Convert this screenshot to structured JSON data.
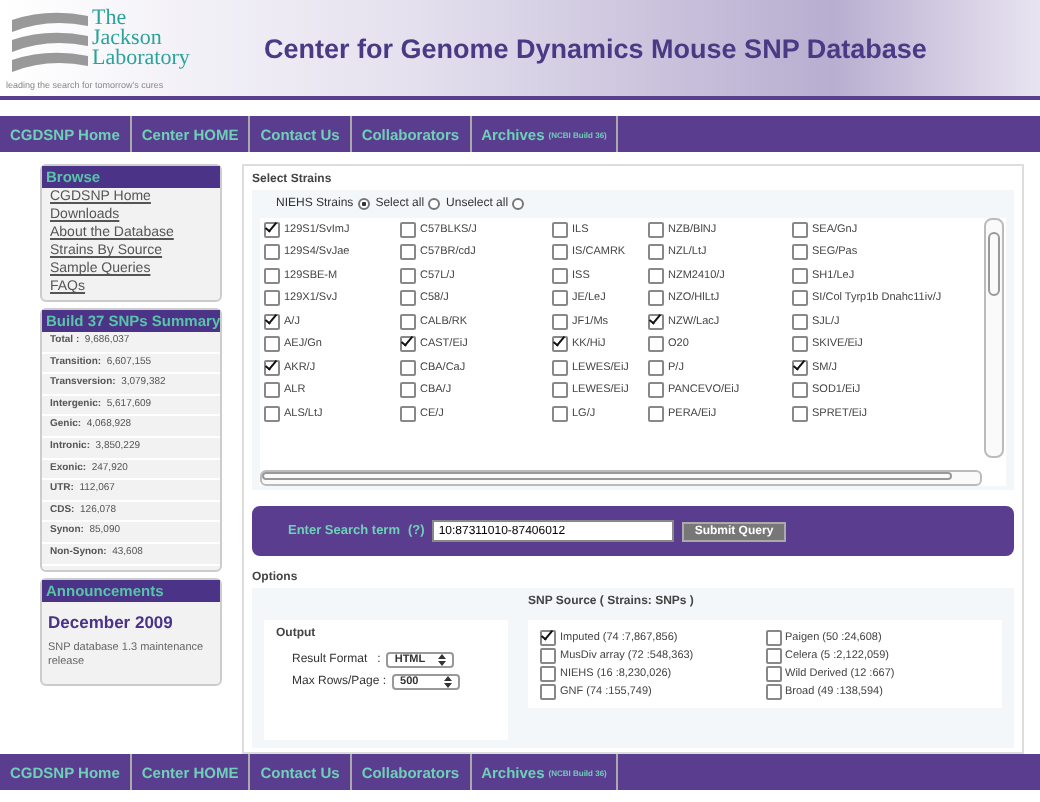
{
  "logo": {
    "line1": "The",
    "line2": "Jackson",
    "line3": "Laboratory",
    "tagline": "leading the search for tomorrow's cures"
  },
  "title": "Center for Genome Dynamics Mouse SNP Database",
  "nav": [
    {
      "label": "CGDSNP Home"
    },
    {
      "label": "Center HOME"
    },
    {
      "label": "Contact Us"
    },
    {
      "label": "Collaborators"
    },
    {
      "label": "Archives",
      "note": "(NCBI Build 36)"
    }
  ],
  "browse": {
    "title": "Browse",
    "links": [
      "CGDSNP Home",
      "Downloads",
      "About the Database",
      "Strains By Source",
      "Sample Queries",
      "FAQs"
    ]
  },
  "summary": {
    "title": "Build 37 SNPs Summary",
    "rows": [
      {
        "label": "Total :",
        "value": "9,686,037"
      },
      {
        "label": "Transition:",
        "value": "6,607,155"
      },
      {
        "label": "Transversion:",
        "value": "3,079,382"
      },
      {
        "label": "Intergenic:",
        "value": "5,617,609"
      },
      {
        "label": "Genic:",
        "value": "4,068,928"
      },
      {
        "label": "Intronic:",
        "value": "3,850,229"
      },
      {
        "label": "Exonic:",
        "value": "247,920"
      },
      {
        "label": "UTR:",
        "value": "112,067"
      },
      {
        "label": "CDS:",
        "value": "126,078"
      },
      {
        "label": "Synon:",
        "value": "85,090"
      },
      {
        "label": "Non-Synon:",
        "value": "43,608"
      }
    ]
  },
  "announcements": {
    "title": "Announcements",
    "date": "December 2009",
    "text": "SNP database 1.3 maintenance release"
  },
  "select_strains": {
    "title": "Select Strains",
    "radios": [
      {
        "label": "NIEHS Strains",
        "selected": true
      },
      {
        "label": "Select all",
        "selected": false
      },
      {
        "label": "Unselect all",
        "selected": false
      }
    ],
    "strains": [
      [
        {
          "label": "129S1/SvImJ",
          "checked": true
        },
        {
          "label": "129S4/SvJae",
          "checked": false
        },
        {
          "label": "129SBE-M",
          "checked": false
        },
        {
          "label": "129X1/SvJ",
          "checked": false
        },
        {
          "label": "A/J",
          "checked": true
        },
        {
          "label": "AEJ/Gn",
          "checked": false
        },
        {
          "label": "AKR/J",
          "checked": true
        },
        {
          "label": "ALR",
          "checked": false
        },
        {
          "label": "ALS/LtJ",
          "checked": false
        }
      ],
      [
        {
          "label": "C57BLKS/J",
          "checked": false
        },
        {
          "label": "C57BR/cdJ",
          "checked": false
        },
        {
          "label": "C57L/J",
          "checked": false
        },
        {
          "label": "C58/J",
          "checked": false
        },
        {
          "label": "CALB/RK",
          "checked": false
        },
        {
          "label": "CAST/EiJ",
          "checked": true
        },
        {
          "label": "CBA/CaJ",
          "checked": false
        },
        {
          "label": "CBA/J",
          "checked": false
        },
        {
          "label": "CE/J",
          "checked": false
        }
      ],
      [
        {
          "label": "ILS",
          "checked": false
        },
        {
          "label": "IS/CAMRK",
          "checked": false
        },
        {
          "label": "ISS",
          "checked": false
        },
        {
          "label": "JE/LeJ",
          "checked": false
        },
        {
          "label": "JF1/Ms",
          "checked": false
        },
        {
          "label": "KK/HiJ",
          "checked": true
        },
        {
          "label": "LEWES/EiJ",
          "checked": false
        },
        {
          "label": "LEWES/EiJ",
          "checked": false
        },
        {
          "label": "LG/J",
          "checked": false
        }
      ],
      [
        {
          "label": "NZB/BlNJ",
          "checked": false
        },
        {
          "label": "NZL/LtJ",
          "checked": false
        },
        {
          "label": "NZM2410/J",
          "checked": false
        },
        {
          "label": "NZO/HlLtJ",
          "checked": false
        },
        {
          "label": "NZW/LacJ",
          "checked": true
        },
        {
          "label": "O20",
          "checked": false
        },
        {
          "label": "P/J",
          "checked": false
        },
        {
          "label": "PANCEVO/EiJ",
          "checked": false
        },
        {
          "label": "PERA/EiJ",
          "checked": false
        }
      ],
      [
        {
          "label": "SEA/GnJ",
          "checked": false
        },
        {
          "label": "SEG/Pas",
          "checked": false
        },
        {
          "label": "SH1/LeJ",
          "checked": false
        },
        {
          "label": "SI/Col Tyrp1b Dnahc11iv/J",
          "checked": false
        },
        {
          "label": "SJL/J",
          "checked": false
        },
        {
          "label": "SKIVE/EiJ",
          "checked": false
        },
        {
          "label": "SM/J",
          "checked": true
        },
        {
          "label": "SOD1/EiJ",
          "checked": false
        },
        {
          "label": "SPRET/EiJ",
          "checked": false
        }
      ]
    ]
  },
  "search": {
    "label": "Enter Search term",
    "help": "(?)",
    "value": "10:87311010-87406012",
    "button": "Submit Query"
  },
  "options": {
    "title": "Options",
    "output_title": "Output",
    "result_format": {
      "label": "Result Format   :",
      "value": "HTML"
    },
    "max_rows": {
      "label": "Max Rows/Page :",
      "value": "500"
    },
    "snp_source_title": "SNP Source ( Strains: SNPs )",
    "sources": [
      {
        "label": "Imputed (74 :7,867,856)",
        "checked": true
      },
      {
        "label": "MusDiv array (72 :548,363)",
        "checked": false
      },
      {
        "label": "NIEHS (16 :8,230,026)",
        "checked": false
      },
      {
        "label": "GNF (74 :155,749)",
        "checked": false
      },
      {
        "label": "Paigen (50 :24,608)",
        "checked": false
      },
      {
        "label": "Celera (5 :2,122,059)",
        "checked": false
      },
      {
        "label": "Wild Derived (12 :667)",
        "checked": false
      },
      {
        "label": "Broad (49 :138,594)",
        "checked": false
      }
    ]
  },
  "footer_nav": [
    {
      "label": "CGDSNP Home"
    },
    {
      "label": "Center HOME"
    },
    {
      "label": "Contact Us"
    },
    {
      "label": "Collaborators"
    },
    {
      "label": "Archives",
      "note": "(NCBI Build 36)"
    }
  ]
}
